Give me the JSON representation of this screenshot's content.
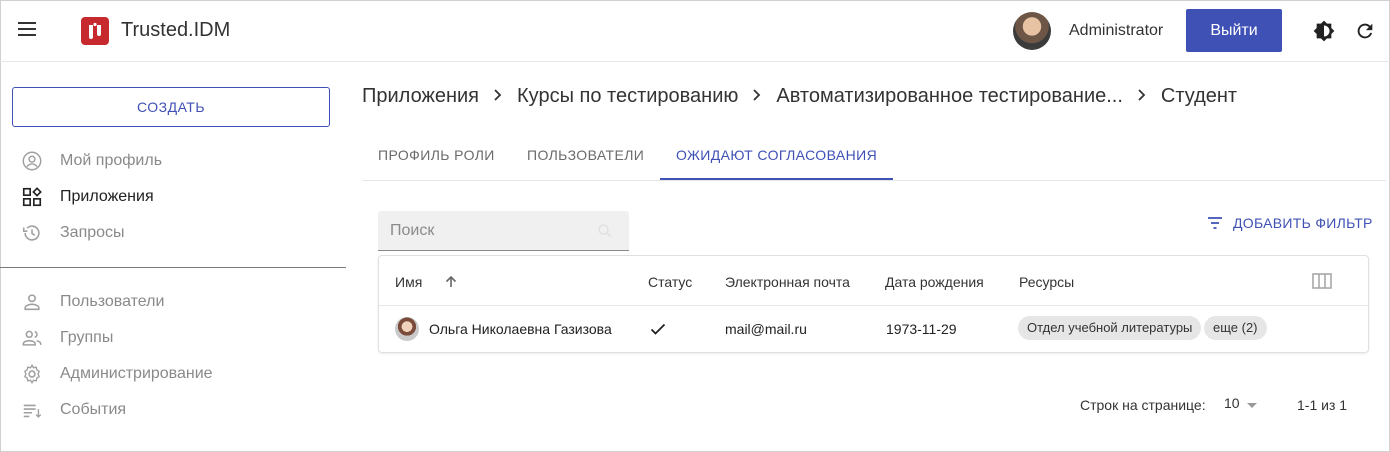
{
  "header": {
    "app_title": "Trusted.IDM",
    "user_name": "Administrator",
    "logout_label": "Выйти",
    "accent_color": "#3f51b5",
    "logo_color": "#c62a2f"
  },
  "sidebar": {
    "create_label": "СОЗДАТЬ",
    "items": [
      {
        "label": "Мой профиль",
        "icon": "account-circle-icon"
      },
      {
        "label": "Приложения",
        "icon": "apps-grid-icon",
        "active": true
      },
      {
        "label": "Запросы",
        "icon": "history-icon"
      },
      {
        "label": "Пользователи",
        "icon": "person-icon"
      },
      {
        "label": "Группы",
        "icon": "group-icon"
      },
      {
        "label": "Администрирование",
        "icon": "settings-icon"
      },
      {
        "label": "События",
        "icon": "event-list-icon"
      }
    ]
  },
  "breadcrumb": [
    "Приложения",
    "Курсы по тестированию",
    "Автоматизированное тестирование...",
    "Студент"
  ],
  "tabs": [
    {
      "label": "ПРОФИЛЬ РОЛИ"
    },
    {
      "label": "ПОЛЬЗОВАТЕЛИ"
    },
    {
      "label": "ОЖИДАЮТ СОГЛАСОВАНИЯ",
      "active": true
    }
  ],
  "search": {
    "placeholder": "Поиск",
    "value": ""
  },
  "filter": {
    "label": "ДОБАВИТЬ ФИЛЬТР"
  },
  "table": {
    "columns": [
      "Имя",
      "Статус",
      "Электронная почта",
      "Дата рождения",
      "Ресурсы"
    ],
    "rows": [
      {
        "name": "Ольга Николаевна Газизова",
        "status_icon": "check-icon",
        "email": "mail@mail.ru",
        "birth_date": "1973-11-29",
        "resources": [
          "Отдел учебной литературы",
          "еще (2)"
        ]
      }
    ]
  },
  "pagination": {
    "rows_per_page_label": "Строк на странице:",
    "rows_per_page": "10",
    "range": "1-1 из 1"
  }
}
